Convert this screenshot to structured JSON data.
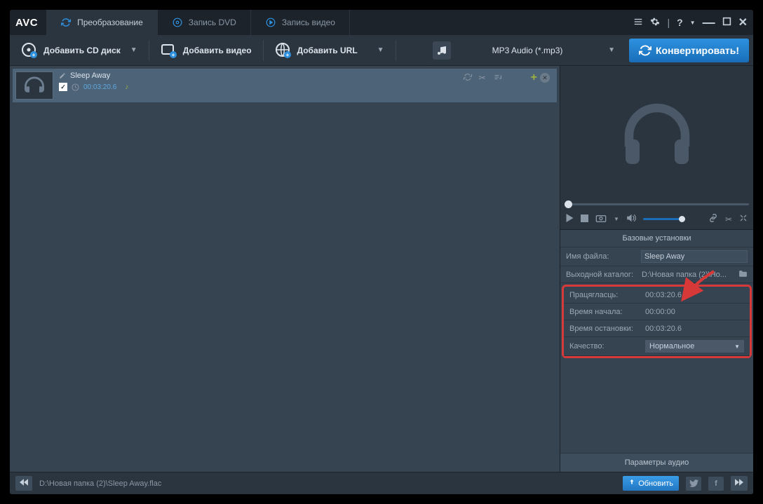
{
  "app": {
    "logo": "AVC"
  },
  "tabs": {
    "convert": "Преобразование",
    "dvd": "Запись DVD",
    "video": "Запись видео"
  },
  "toolbar": {
    "add_cd": "Добавить CD диск",
    "add_video": "Добавить видео",
    "add_url": "Добавить URL",
    "format": "MP3 Audio (*.mp3)",
    "convert": "Конвертировать!"
  },
  "file": {
    "title": "Sleep Away",
    "duration": "00:03:20.6"
  },
  "settings": {
    "header": "Базовые установки",
    "filename_label": "Имя файла:",
    "filename_value": "Sleep Away",
    "outdir_label": "Выходной каталог:",
    "outdir_value": "D:\\Новая папка (2)\\Но...",
    "duration_label": "Працягласць:",
    "duration_value": "00:03:20.6",
    "start_label": "Время начала:",
    "start_value": "00:00:00",
    "stop_label": "Время остановки:",
    "stop_value": "00:03:20.6",
    "quality_label": "Качество:",
    "quality_value": "Нормальное",
    "audio_params": "Параметры аудио"
  },
  "statusbar": {
    "path": "D:\\Новая папка (2)\\Sleep Away.flac",
    "update": "Обновить"
  }
}
